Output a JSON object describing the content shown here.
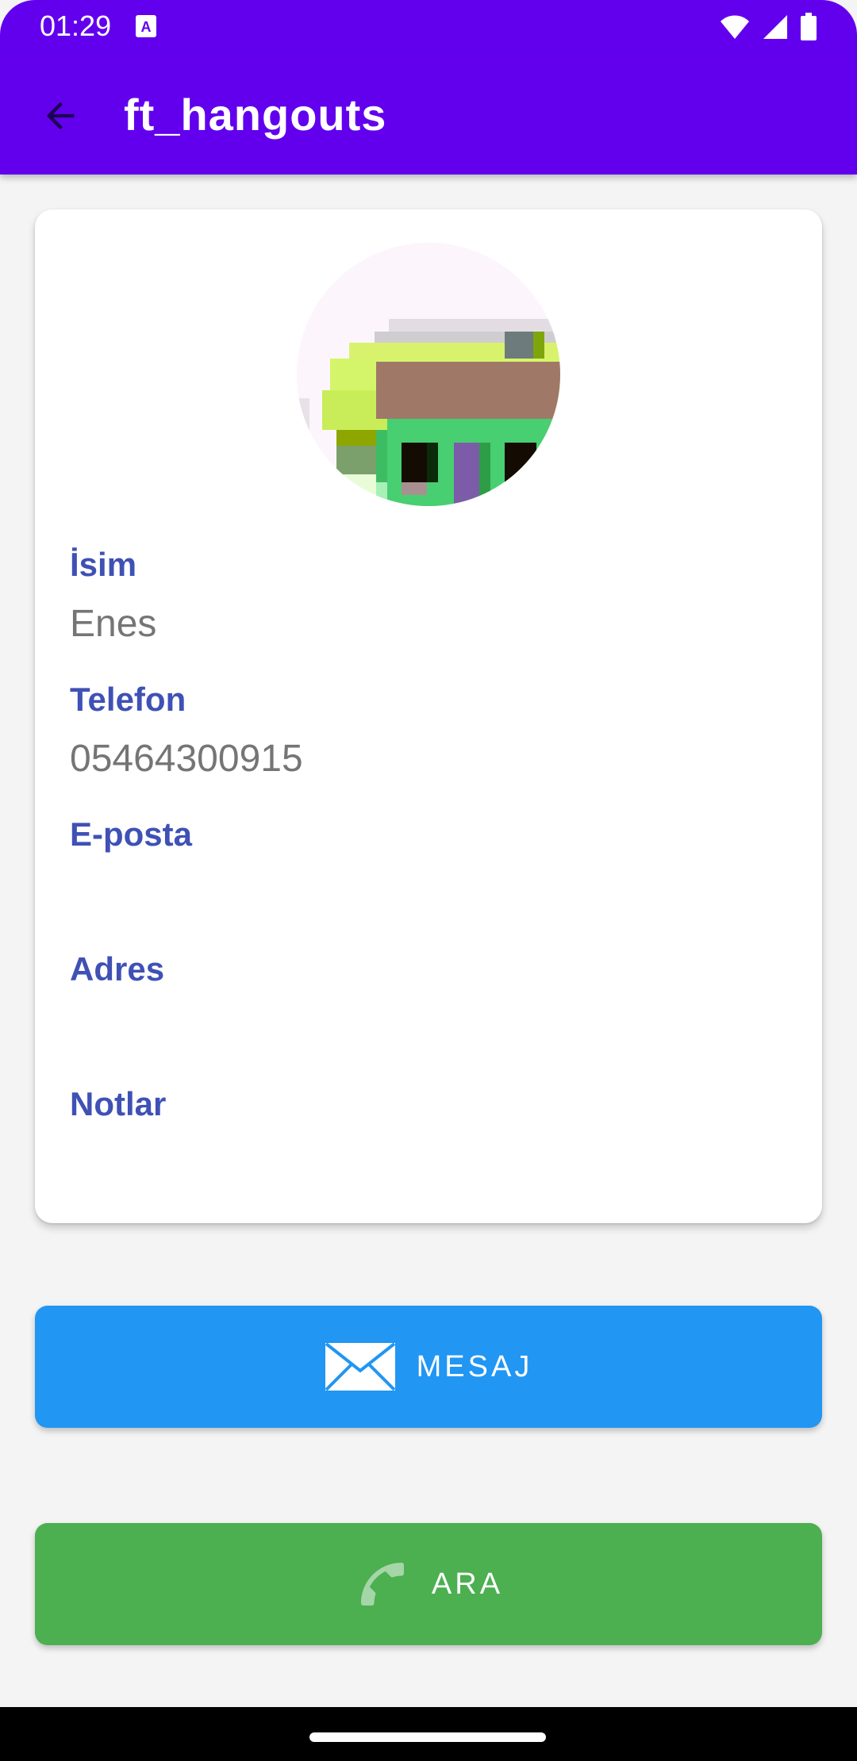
{
  "status_bar": {
    "time": "01:29",
    "icons": [
      "keyboard-a-icon",
      "wifi-icon",
      "signal-icon",
      "battery-icon"
    ]
  },
  "app_bar": {
    "title": "ft_hangouts",
    "back_icon": "arrow-back-icon"
  },
  "contact": {
    "avatar_icon": "pixel-art-photo",
    "fields": [
      {
        "label": "İsim",
        "value": "Enes"
      },
      {
        "label": "Telefon",
        "value": "05464300915"
      },
      {
        "label": "E-posta",
        "value": ""
      },
      {
        "label": "Adres",
        "value": ""
      },
      {
        "label": "Notlar",
        "value": ""
      }
    ]
  },
  "actions": {
    "message": {
      "label": "MESAJ",
      "icon": "envelope-icon",
      "color": "#2196f3"
    },
    "call": {
      "label": "ARA",
      "icon": "phone-icon",
      "color": "#4caf50"
    }
  },
  "colors": {
    "primary": "#6200ee",
    "label": "#3f51b5",
    "value": "#757575"
  }
}
